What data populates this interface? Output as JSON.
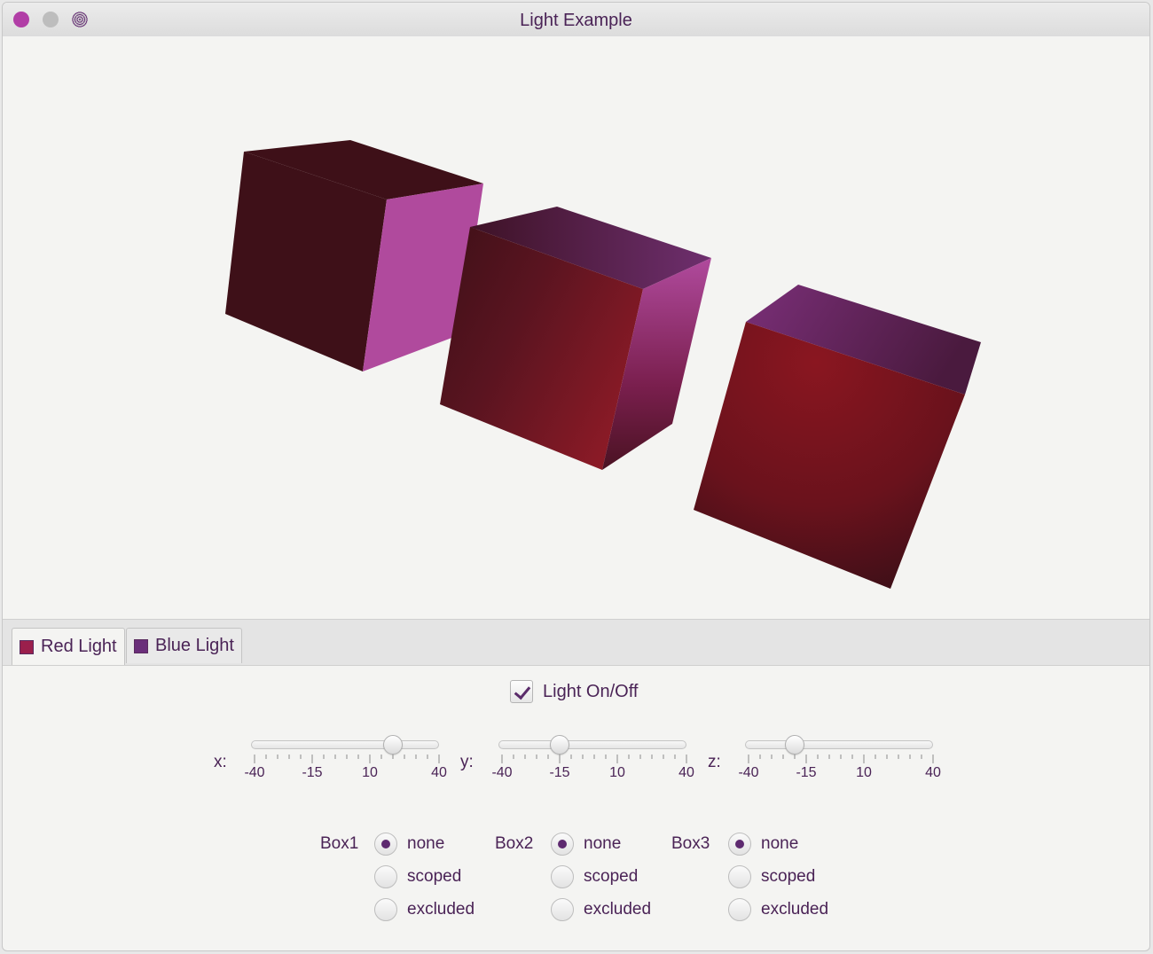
{
  "window": {
    "title": "Light Example"
  },
  "scene": {
    "light_colors": {
      "red": "#7a121c",
      "blue": "#5e2a70",
      "accent": "#b04a9d"
    }
  },
  "tabs": [
    {
      "label": "Red Light",
      "color": "#9b1f4c",
      "active": true
    },
    {
      "label": "Blue Light",
      "color": "#6a2e7a",
      "active": false
    }
  ],
  "light_toggle": {
    "label": "Light On/Off",
    "checked": true
  },
  "sliders": [
    {
      "label": "x:",
      "value": 20,
      "min": -40,
      "max": 40,
      "tick_labels": [
        "-40",
        "-15",
        "10",
        "40"
      ]
    },
    {
      "label": "y:",
      "value": -15,
      "min": -40,
      "max": 40,
      "tick_labels": [
        "-40",
        "-15",
        "10",
        "40"
      ]
    },
    {
      "label": "z:",
      "value": -20,
      "min": -40,
      "max": 40,
      "tick_labels": [
        "-40",
        "-15",
        "10",
        "40"
      ]
    }
  ],
  "boxes": [
    {
      "label": "Box1",
      "options": [
        "none",
        "scoped",
        "excluded"
      ],
      "selected": "none"
    },
    {
      "label": "Box2",
      "options": [
        "none",
        "scoped",
        "excluded"
      ],
      "selected": "none"
    },
    {
      "label": "Box3",
      "options": [
        "none",
        "scoped",
        "excluded"
      ],
      "selected": "none"
    }
  ]
}
